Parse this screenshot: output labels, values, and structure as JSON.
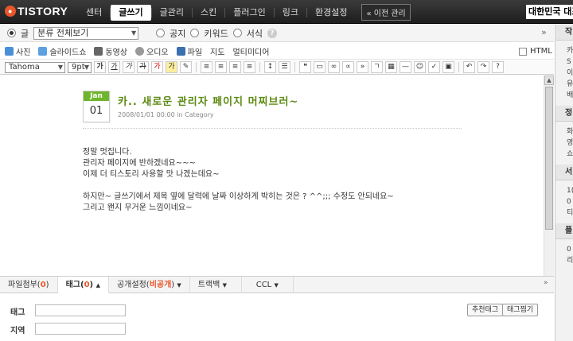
{
  "header": {
    "logo": "TISTORY",
    "nav": [
      "센터",
      "글쓰기",
      "글관리",
      "스킨",
      "플러그인",
      "링크",
      "환경설정"
    ],
    "old_admin": "« 이전 관리",
    "top_right_text": "대한민국 대표"
  },
  "category_row": {
    "type_post": "글",
    "category_select": "분류 전체보기",
    "type_notice": "공지",
    "type_keyword": "키워드",
    "type_form": "서식",
    "collapse": "»"
  },
  "media_toolbar": {
    "items": [
      "사진",
      "슬라이드쇼",
      "동영상",
      "오디오",
      "파일",
      "지도",
      "멀티미디어"
    ],
    "html_label": "HTML"
  },
  "format_toolbar": {
    "font": "Tahoma",
    "size": "9pt",
    "buttons": [
      "가",
      "가",
      "가",
      "가",
      "가",
      "가"
    ]
  },
  "post": {
    "month": "Jan",
    "day": "01",
    "title": "카.. 새로운 관리자 페이지 머찌브러~",
    "meta": "2008/01/01 00:00 in Category",
    "lines": [
      "정말 멋집니다.",
      "관리자 페이지에 반하겠네요~~~",
      "이제 더 티스토리 사용할 맛 나겠는데요~",
      "",
      "하지만~ 글쓰기에서 제목 옆에 달력에 날짜 이상하게 박히는 것은 ? ^^;;; 수정도 안되네요~",
      "그리고 왠지 무거운 느낌이네요~"
    ]
  },
  "tabs": {
    "attach": "파일첨부(",
    "attach_count": "0",
    "attach_end": ")",
    "tag": "태그(",
    "tag_count": "0",
    "tag_end": ")",
    "publish": "공개설정(",
    "publish_state": "비공개",
    "publish_end": ")",
    "trackback": "트랙백",
    "ccl": "CCL"
  },
  "tag_panel": {
    "tag_label": "태그",
    "location_label": "지역",
    "recommend_button": "추천태그",
    "fetch_button": "태그찜기"
  },
  "sidebar": {
    "head1": "작",
    "lines1": [
      "카",
      "S",
      "이",
      "유",
      "배"
    ],
    "head2": "정",
    "lines2": [
      "화",
      "영",
      "쇼"
    ],
    "head3": "서",
    "lines3": [
      "1(",
      "0",
      "티"
    ],
    "head4": "플",
    "lines4": [
      "0",
      "리"
    ]
  },
  "colors": {
    "accent_green": "#6fb52c",
    "title_green": "#5b8a12",
    "highlight_orange": "#e8572a"
  }
}
